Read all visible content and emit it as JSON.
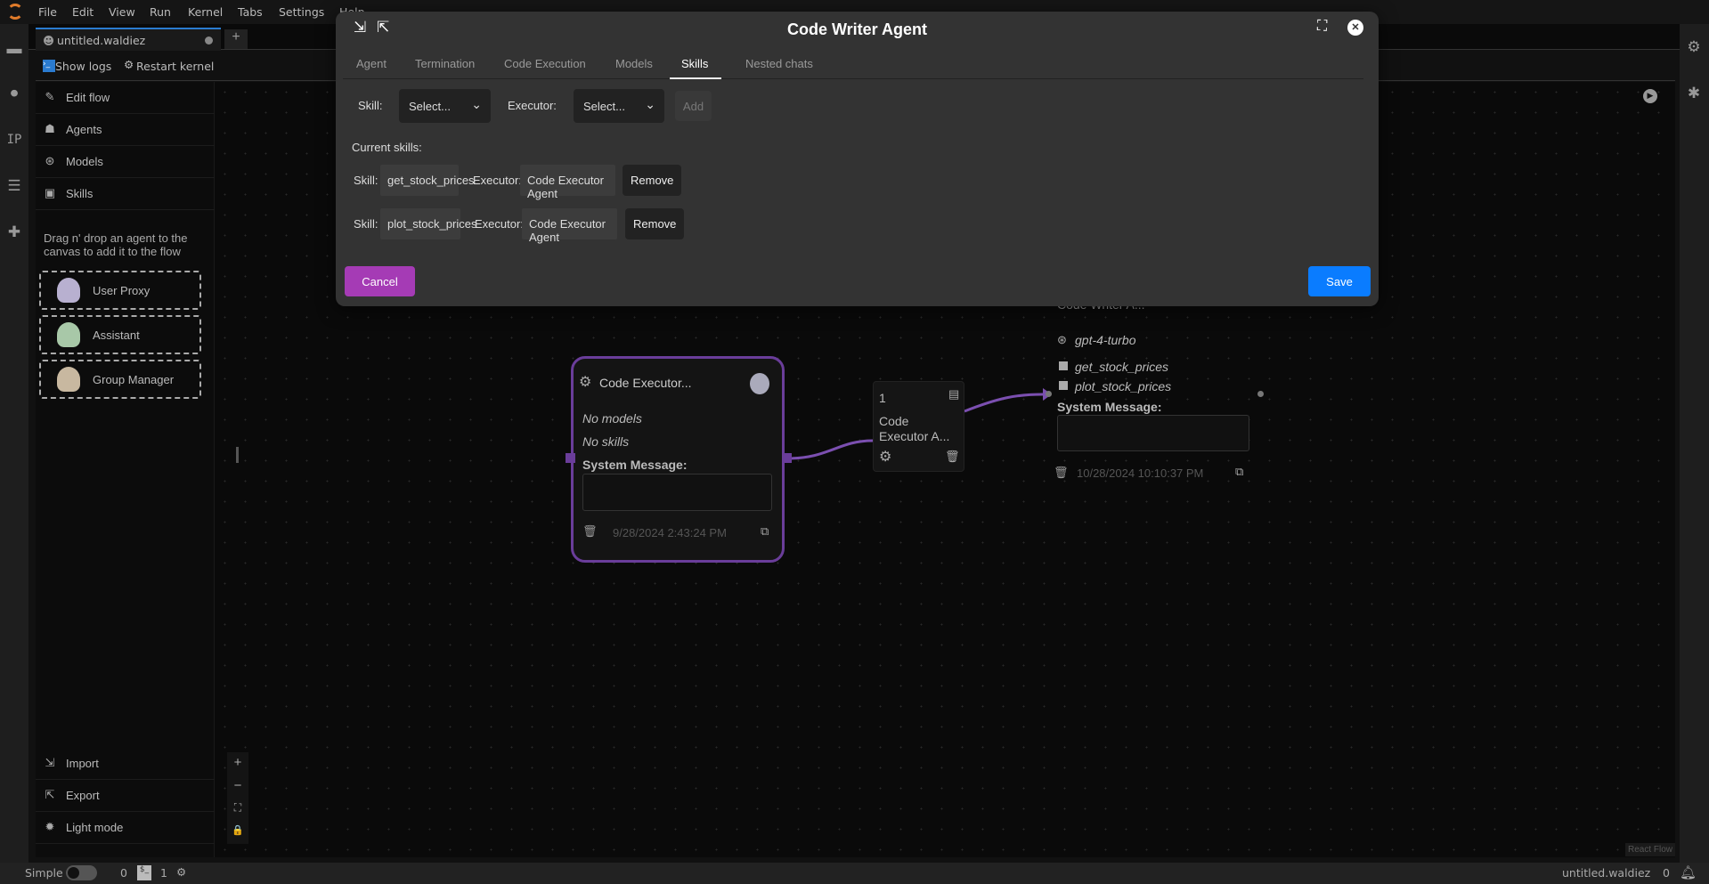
{
  "menu": [
    "File",
    "Edit",
    "View",
    "Run",
    "Kernel",
    "Tabs",
    "Settings",
    "Help"
  ],
  "tab": {
    "title": "untitled.waldiez",
    "new_tab": "+"
  },
  "toolbar": {
    "show_logs": "Show logs",
    "restart_kernel": "Restart kernel"
  },
  "sidebar": {
    "items": [
      {
        "label": "Edit flow",
        "icon": "edit-icon"
      },
      {
        "label": "Agents",
        "icon": "robot-icon"
      },
      {
        "label": "Models",
        "icon": "openai-icon"
      },
      {
        "label": "Skills",
        "icon": "terminal-icon"
      }
    ],
    "hint": "Drag n' drop an agent to the canvas to add it to the flow",
    "agents": [
      "User Proxy",
      "Assistant",
      "Group Manager"
    ],
    "bottom": [
      {
        "label": "Import",
        "icon": "import-icon"
      },
      {
        "label": "Export",
        "icon": "export-icon"
      },
      {
        "label": "Light mode",
        "icon": "sun-icon"
      }
    ]
  },
  "canvas": {
    "executor_node": {
      "title": "Code Executor...",
      "models": "No models",
      "skills": "No skills",
      "system_message_label": "System Message:",
      "timestamp": "9/28/2024 2:43:24 PM"
    },
    "edge_node": {
      "order": "1",
      "label_line1": "Code",
      "label_line2": "Executor A..."
    },
    "writer_node": {
      "title": "Code Writer A...",
      "model": "gpt-4-turbo",
      "skills": [
        "get_stock_prices",
        "plot_stock_prices"
      ],
      "system_message_label": "System Message:",
      "timestamp": "10/28/2024 10:10:37 PM"
    },
    "attribution": "React Flow",
    "edge_color": "#7b4fb0"
  },
  "modal": {
    "title": "Code Writer Agent",
    "tabs": [
      "Agent",
      "Termination",
      "Code Execution",
      "Models",
      "Skills",
      "Nested chats"
    ],
    "active_tab": "Skills",
    "skill_label": "Skill:",
    "skill_select": "Select...",
    "executor_label": "Executor:",
    "executor_select": "Select...",
    "add": "Add",
    "current_skills_label": "Current skills:",
    "current_skills": [
      {
        "skill": "get_stock_prices",
        "executor": "Code Executor Agent",
        "remove": "Remove"
      },
      {
        "skill": "plot_stock_prices",
        "executor": "Code Executor Agent",
        "remove": "Remove"
      }
    ],
    "cancel": "Cancel",
    "save": "Save",
    "cancel_color": "#a53bb5",
    "save_color": "#0a7cff"
  },
  "status": {
    "mode": "Simple",
    "count1": "0",
    "count2": "1",
    "filename": "untitled.waldiez",
    "notifications": "0"
  }
}
